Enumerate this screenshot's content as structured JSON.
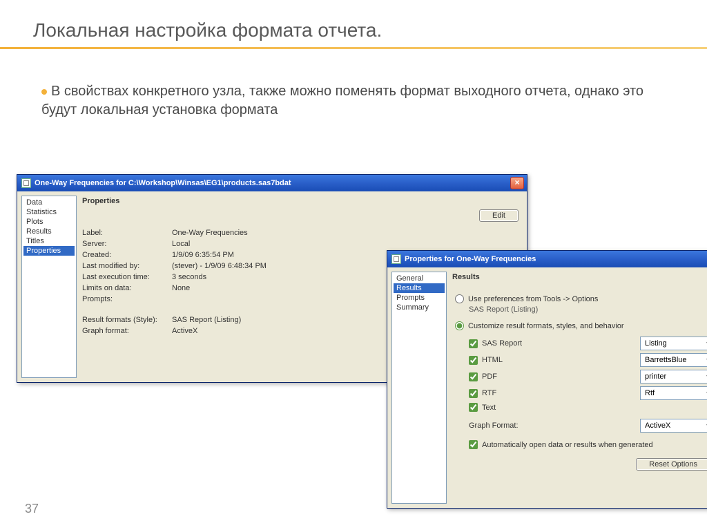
{
  "slide": {
    "title": "Локальная настройка формата отчета.",
    "bullet": "В свойствах конкретного узла, также можно поменять формат выходного отчета, однако это будут локальная установка формата",
    "page_number": "37"
  },
  "window1": {
    "title": "One-Way Frequencies for C:\\Workshop\\Winsas\\EG1\\products.sas7bdat",
    "sidebar": [
      "Data",
      "Statistics",
      "Plots",
      "Results",
      "Titles",
      "Properties"
    ],
    "sidebar_selected": 5,
    "header": "Properties",
    "edit_button": "Edit",
    "rows": [
      {
        "label": "Label:",
        "value": "One-Way Frequencies"
      },
      {
        "label": "Server:",
        "value": "Local"
      },
      {
        "label": "Created:",
        "value": "1/9/09 6:35:54 PM"
      },
      {
        "label": "Last modified by:",
        "value": " (stever) - 1/9/09 6:48:34 PM"
      },
      {
        "label": "Last execution time:",
        "value": "3 seconds"
      },
      {
        "label": "Limits on data:",
        "value": "None"
      },
      {
        "label": "Prompts:",
        "value": ""
      },
      {
        "label": "Result formats (Style):",
        "value": "SAS Report (Listing)"
      },
      {
        "label": "Graph format:",
        "value": "ActiveX"
      }
    ]
  },
  "window2": {
    "title": "Properties for One-Way Frequencies",
    "sidebar": [
      "General",
      "Results",
      "Prompts",
      "Summary"
    ],
    "sidebar_selected": 1,
    "header": "Results",
    "radio_use_pref": "Use preferences from Tools -> Options",
    "radio_use_pref_sub": "SAS Report (Listing)",
    "radio_customize": "Customize result formats, styles, and behavior",
    "formats": [
      {
        "label": "SAS Report",
        "combo": "Listing",
        "checked": true
      },
      {
        "label": "HTML",
        "combo": "BarrettsBlue",
        "checked": true
      },
      {
        "label": "PDF",
        "combo": "printer",
        "checked": true
      },
      {
        "label": "RTF",
        "combo": "Rtf",
        "checked": true
      },
      {
        "label": "Text",
        "combo": "",
        "checked": true
      }
    ],
    "graph_format_label": "Graph Format:",
    "graph_format_value": "ActiveX",
    "auto_open": "Automatically open data or results when generated",
    "reset": "Reset Options"
  }
}
